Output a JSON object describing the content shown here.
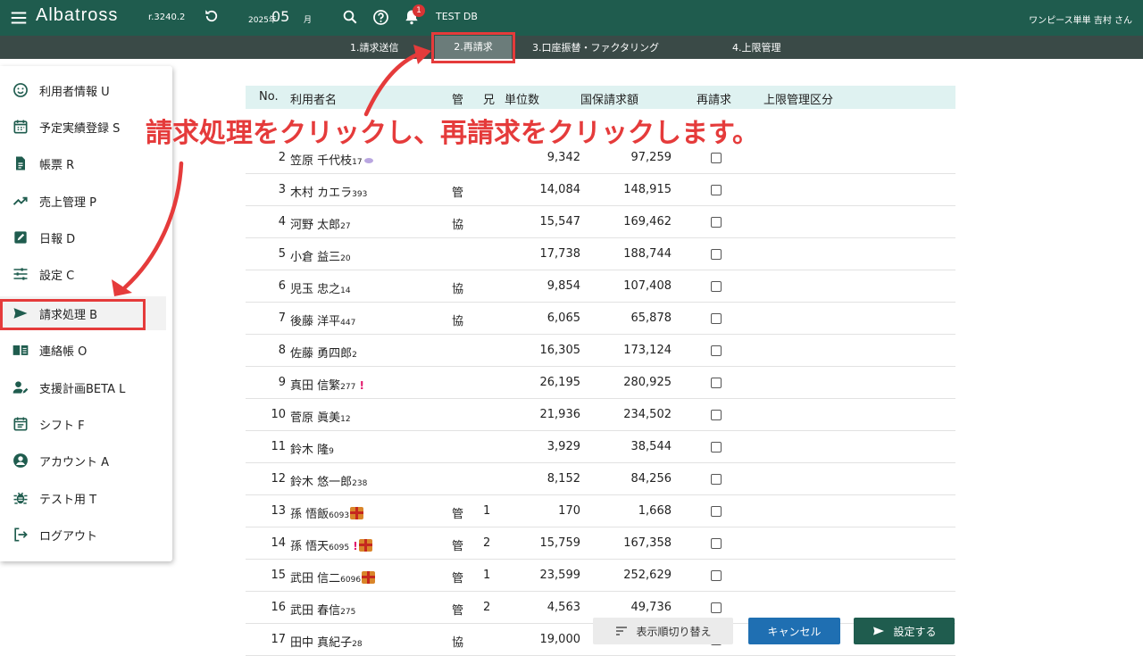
{
  "header": {
    "app_name": "Albatross",
    "version": "r.3240.2",
    "year": "2025年",
    "month": "05",
    "month_unit": "月",
    "notification_count": "1",
    "db_name": "TEST DB",
    "user_name": "ワンピース単単 吉村 さん"
  },
  "steps": [
    "1.請求送信",
    "2.再請求",
    "3.口座振替・ファクタリング",
    "4.上限管理"
  ],
  "sidebar": {
    "items": [
      {
        "label": "利用者情報 U",
        "icon": "smiley-icon"
      },
      {
        "label": "予定実績登録 S",
        "icon": "calendar-icon"
      },
      {
        "label": "帳票 R",
        "icon": "document-icon"
      },
      {
        "label": "売上管理 P",
        "icon": "trend-icon"
      },
      {
        "label": "日報 D",
        "icon": "edit-icon"
      },
      {
        "label": "設定 C",
        "icon": "sliders-icon"
      },
      {
        "label": "請求処理 B",
        "icon": "send-icon"
      },
      {
        "label": "連絡帳 O",
        "icon": "book-icon"
      },
      {
        "label": "支援計画BETA L",
        "icon": "person-edit-icon"
      },
      {
        "label": "シフト F",
        "icon": "shift-icon"
      },
      {
        "label": "アカウント A",
        "icon": "account-icon"
      },
      {
        "label": "テスト用 T",
        "icon": "bug-icon"
      },
      {
        "label": "ログアウト",
        "icon": "logout-icon"
      }
    ]
  },
  "table": {
    "headers": {
      "no": "No.",
      "name": "利用者名",
      "kan": "管",
      "kyo": "兄",
      "units": "単位数",
      "amount": "国保請求額",
      "rebill": "再請求",
      "limit": "上限管理区分"
    },
    "rows": [
      {
        "no": "2",
        "name": "笠原 千代枝",
        "id": "17",
        "kan": "",
        "kyo": "",
        "units": "9,342",
        "amount": "97,259"
      },
      {
        "no": "3",
        "name": "木村 カエラ",
        "id": "393",
        "kan": "管",
        "kyo": "",
        "units": "14,084",
        "amount": "148,915"
      },
      {
        "no": "4",
        "name": "河野 太郎",
        "id": "27",
        "kan": "協",
        "kyo": "",
        "units": "15,547",
        "amount": "169,462"
      },
      {
        "no": "5",
        "name": "小倉 益三",
        "id": "20",
        "kan": "",
        "kyo": "",
        "units": "17,738",
        "amount": "188,744"
      },
      {
        "no": "6",
        "name": "児玉 忠之",
        "id": "14",
        "kan": "協",
        "kyo": "",
        "units": "9,854",
        "amount": "107,408"
      },
      {
        "no": "7",
        "name": "後藤 洋平",
        "id": "447",
        "kan": "協",
        "kyo": "",
        "units": "6,065",
        "amount": "65,878"
      },
      {
        "no": "8",
        "name": "佐藤 勇四郎",
        "id": "2",
        "kan": "",
        "kyo": "",
        "units": "16,305",
        "amount": "173,124"
      },
      {
        "no": "9",
        "name": "真田 信繁",
        "id": "277",
        "mark": "!",
        "kan": "",
        "kyo": "",
        "units": "26,195",
        "amount": "280,925"
      },
      {
        "no": "10",
        "name": "菅原 眞美",
        "id": "12",
        "kan": "",
        "kyo": "",
        "units": "21,936",
        "amount": "234,502"
      },
      {
        "no": "11",
        "name": "鈴木 隆",
        "id": "9",
        "kan": "",
        "kyo": "",
        "units": "3,929",
        "amount": "38,544"
      },
      {
        "no": "12",
        "name": "鈴木 悠一郎",
        "id": "238",
        "kan": "",
        "kyo": "",
        "units": "8,152",
        "amount": "84,256"
      },
      {
        "no": "13",
        "name": "孫 悟飯",
        "id": "6093",
        "gift": true,
        "kan": "管",
        "kyo": "1",
        "units": "170",
        "amount": "1,668"
      },
      {
        "no": "14",
        "name": "孫 悟天",
        "id": "6095",
        "mark": "!",
        "gift": true,
        "kan": "管",
        "kyo": "2",
        "units": "15,759",
        "amount": "167,358"
      },
      {
        "no": "15",
        "name": "武田 信二",
        "id": "6096",
        "gift": true,
        "kan": "管",
        "kyo": "1",
        "units": "23,599",
        "amount": "252,629"
      },
      {
        "no": "16",
        "name": "武田 春信",
        "id": "275",
        "kan": "管",
        "kyo": "2",
        "units": "4,563",
        "amount": "49,736"
      },
      {
        "no": "17",
        "name": "田中 真紀子",
        "id": "28",
        "kan": "協",
        "kyo": "",
        "units": "19,000",
        "amount": ""
      }
    ]
  },
  "annotation": "請求処理をクリックし、再請求をクリックします。",
  "buttons": {
    "sort": "表示順切り替え",
    "cancel": "キャンセル",
    "save": "設定する"
  },
  "colors": {
    "header": "#1f5c4e",
    "stepbar": "#3a4a47",
    "accent_red": "#e53b3b",
    "table_header": "#dff2f1",
    "cancel_blue": "#1f6fb2"
  }
}
